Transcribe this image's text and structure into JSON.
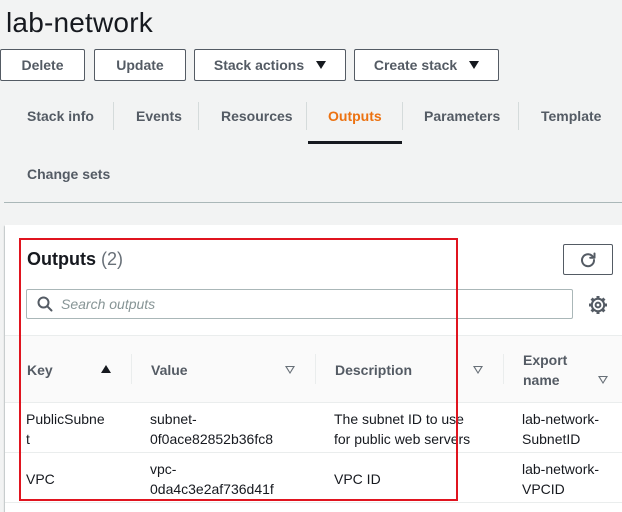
{
  "page": {
    "title": "lab-network"
  },
  "actions": {
    "delete_label": "Delete",
    "update_label": "Update",
    "stack_actions_label": "Stack actions",
    "create_stack_label": "Create stack"
  },
  "tabs": {
    "stack_info": "Stack info",
    "events": "Events",
    "resources": "Resources",
    "outputs": "Outputs",
    "parameters": "Parameters",
    "template": "Template",
    "change_sets": "Change sets",
    "active": "Outputs"
  },
  "outputs": {
    "title": "Outputs",
    "count": "(2)",
    "search_placeholder": "Search outputs",
    "columns": {
      "key": "Key",
      "value": "Value",
      "description": "Description",
      "export_name_line1": "Export",
      "export_name_line2": "name"
    },
    "rows": [
      {
        "key_line1": "PublicSubne",
        "key_line2": "t",
        "value_line1": "subnet-",
        "value_line2": "0f0ace82852b36fc8",
        "description_line1": "The subnet ID to use",
        "description_line2": "for public web servers",
        "export_line1": "lab-network-",
        "export_line2": "SubnetID"
      },
      {
        "key_line1": "VPC",
        "value_line1": "vpc-",
        "value_line2": "0da4c3e2af736d41f",
        "description_line1": "VPC ID",
        "export_line1": "lab-network-",
        "export_line2": "VPCID"
      }
    ]
  },
  "colors": {
    "accent": "#ec7211",
    "highlight_border": "#e0141f"
  },
  "icons": {
    "refresh": "refresh-icon",
    "search": "search-icon",
    "settings": "gear-icon",
    "dropdown": "caret-down-icon",
    "sort_ascending": "sort-ascending-icon",
    "sort_unsorted": "sort-unsorted-icon"
  }
}
